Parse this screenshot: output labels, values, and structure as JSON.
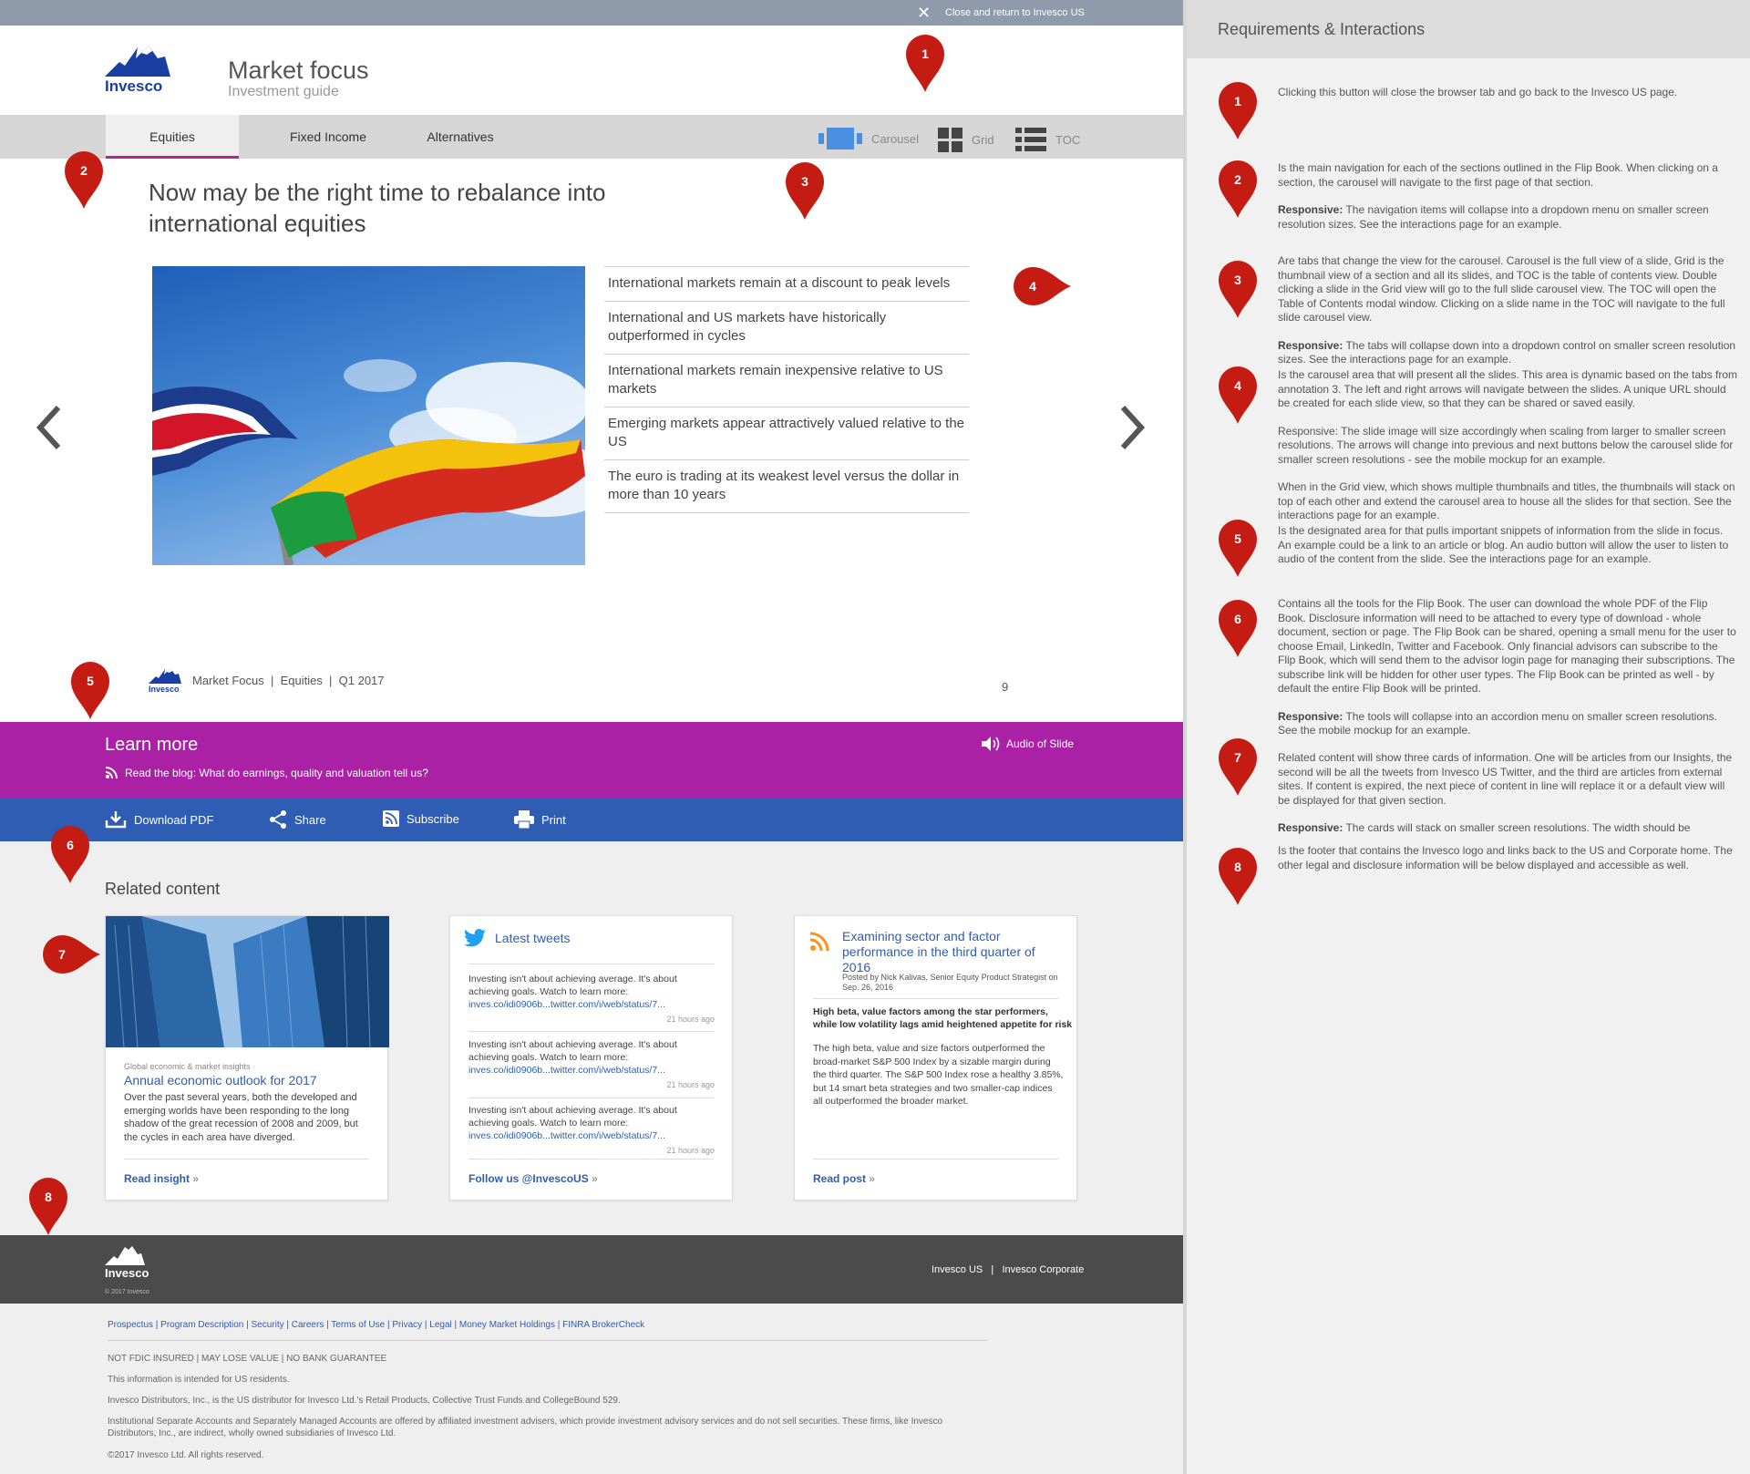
{
  "topbar": {
    "close_label": "Close and return to Invesco US"
  },
  "header": {
    "logo": "Invesco",
    "title": "Market focus",
    "subtitle": "Investment guide"
  },
  "nav": {
    "tabs": [
      "Equities",
      "Fixed Income",
      "Alternatives"
    ],
    "views": [
      "Carousel",
      "Grid",
      "TOC"
    ]
  },
  "slide": {
    "title": "Now may be the right time to rebalance into international equities",
    "bullets": [
      "International markets remain at a discount to peak levels",
      "International and US markets have historically outperformed in cycles",
      "International markets remain inexpensive relative to US markets",
      "Emerging markets appear attractively valued relative to the US",
      "The euro is trading at its weakest level versus the dollar in more than 10 years"
    ],
    "footer": {
      "logo": "Invesco",
      "text": "Market Focus  |  Equities  |  Q1 2017",
      "page": "9"
    }
  },
  "learn": {
    "title": "Learn more",
    "link": "Read the blog: What do earnings, quality and valuation tell us?",
    "audio": "Audio of Slide"
  },
  "tools": [
    "Download PDF",
    "Share",
    "Subscribe",
    "Print"
  ],
  "related": {
    "heading": "Related content",
    "insight": {
      "eyebrow": "Global economic & market insights",
      "title": "Annual economic outlook for 2017",
      "body": "Over the past several years, both the developed and emerging worlds have been responding to the long shadow of the great recession of 2008 and 2009, but the cycles in each area have diverged.",
      "cta": "Read insight"
    },
    "tweets": {
      "title": "Latest tweets",
      "items": [
        {
          "text": "Investing isn't about achieving average. It's about achieving goals. Watch to learn more: ",
          "link": "inves.co/idi0906b...twitter.com/i/web/status/7...",
          "time": "21 hours ago"
        },
        {
          "text": "Investing isn't about achieving average. It's about achieving goals. Watch to learn more: ",
          "link": "inves.co/idi0906b...twitter.com/i/web/status/7...",
          "time": "21 hours ago"
        },
        {
          "text": "Investing isn't about achieving average. It's about achieving goals. Watch to learn more: ",
          "link": "inves.co/idi0906b...twitter.com/i/web/status/7...",
          "time": "21 hours ago"
        }
      ],
      "cta": "Follow us @InvescoUS"
    },
    "post": {
      "title": "Examining sector and factor performance in the third quarter of 2016",
      "byline": "Posted by Nick Kalivas, Senior Equity Product Strategist on  Sep. 26, 2016",
      "lede": "High beta, value factors among the star performers, while low volatility lags amid heightened appetite for risk",
      "body": "The high beta, value and size factors outperformed the broad-market S&P 500 Index by a sizable margin during the third quarter. The S&P 500 Index rose a healthy 3.85%, but 14 smart beta strategies and two smaller-cap indices all outperformed the broader market.",
      "cta": "Read post"
    }
  },
  "footer": {
    "logo": "Invesco",
    "copyright": "© 2017 Invesco",
    "links": "Invesco US   |   Invesco Corporate"
  },
  "legal": {
    "links": "Prospectus | Program Description | Security | Careers | Terms of Use | Privacy | Legal | Money Market Holdings | FINRA BrokerCheck",
    "lines": [
      "NOT FDIC INSURED | MAY LOSE VALUE | NO BANK GUARANTEE",
      "This information is intended for US residents.",
      "Invesco Distributors, Inc., is the US distributor for Invesco Ltd.'s Retail Products, Collective Trust Funds and CollegeBound 529.",
      "Institutional Separate Accounts and Separately Managed Accounts are offered by affiliated investment advisers, which provide investment advisory services and do not sell securities. These firms, like Invesco Distributors, Inc., are indirect, wholly owned subsidiaries of Invesco Ltd.",
      "©2017 Invesco Ltd. All rights reserved."
    ]
  },
  "pins": [
    "1",
    "2",
    "3",
    "4",
    "5",
    "6",
    "7",
    "8"
  ],
  "panel": {
    "title": "Requirements & Interactions",
    "req1": "Clicking this button will close the browser tab and go back to the Invesco US page.",
    "req2a": "Is the main navigation for each of the sections outlined in the Flip Book. When clicking on a section, the carousel will navigate to the first page of that section.",
    "req2b_label": "Responsive:",
    "req2b": " The navigation items will collapse into a dropdown menu on smaller screen resolution sizes. See the interactions page for an example.",
    "req3a": "Are tabs that change the view for the carousel. Carousel is the full view of a slide, Grid is the thumbnail view of a section and all its slides, and TOC is the table of contents view. Double clicking a slide in the Grid view will go to the full slide carousel view. The TOC will open the Table of Contents modal window. Clicking on a slide name in the TOC will navigate to the full slide carousel view.",
    "req3b_label": "Responsive:",
    "req3b": " The tabs will collapse down into a dropdown control on smaller screen resolution sizes. See the interactions page for an example.",
    "req4a": "Is the carousel area that will present all the slides. This area is dynamic based on the tabs from annotation 3. The left and right arrows will navigate between the slides. A unique URL should be created for each slide view, so that they can be shared or saved easily.",
    "req4b": "Responsive: The slide image will size accordingly when scaling from larger to smaller screen resolutions. The arrows will change into previous and next buttons below the carousel slide for smaller screen resolutions - see the mobile mockup for an example.",
    "req4c": "When in the Grid view, which shows multiple thumbnails and titles, the thumbnails will stack on top of each other and extend the carousel area to house all the slides for that section. See the interactions page for an example.",
    "req5": "Is the designated area for that pulls important snippets of information from the slide in focus. An example could be a link to an article or blog. An audio button will allow the user to listen to audio of the content from the slide. See the interactions page for an example.",
    "req6a": "Contains all the tools for the Flip Book. The user can download the whole PDF of the Flip Book. Disclosure information will need to be attached to every type of download - whole document, section or page. The Flip Book can be shared, opening a small menu for the user to choose Email, LinkedIn, Twitter and Facebook. Only financial advisors can subscribe to the Flip Book, which will send them to the advisor login page for managing their subscriptions. The subscribe link will be hidden for other user types. The Flip Book can be printed as well - by default the entire Flip Book will be printed.",
    "req6b_label": "Responsive:",
    "req6b": " The tools will collapse into an accordion menu on smaller screen resolutions. See the mobile mockup for an example.",
    "req7a": "Related content will show three cards of information. One will be articles from our Insights, the second will be all the tweets from Invesco US Twitter, and the third are articles from external sites. If content is expired, the next piece of content in line will replace it or a default view will be displayed for that given section.",
    "req7b_label": "Responsive:",
    "req7b": " The cards will stack on smaller screen resolutions. The width should be",
    "req8": "Is the footer that contains the Invesco logo and links back to the US and Corporate home. The other legal and disclosure information will be below displayed and accessible as well."
  },
  "colors": {
    "purple": "#ab21a5",
    "blue": "#2f5db3",
    "pin": "#c41b12",
    "brand": "#1a3fa3"
  }
}
